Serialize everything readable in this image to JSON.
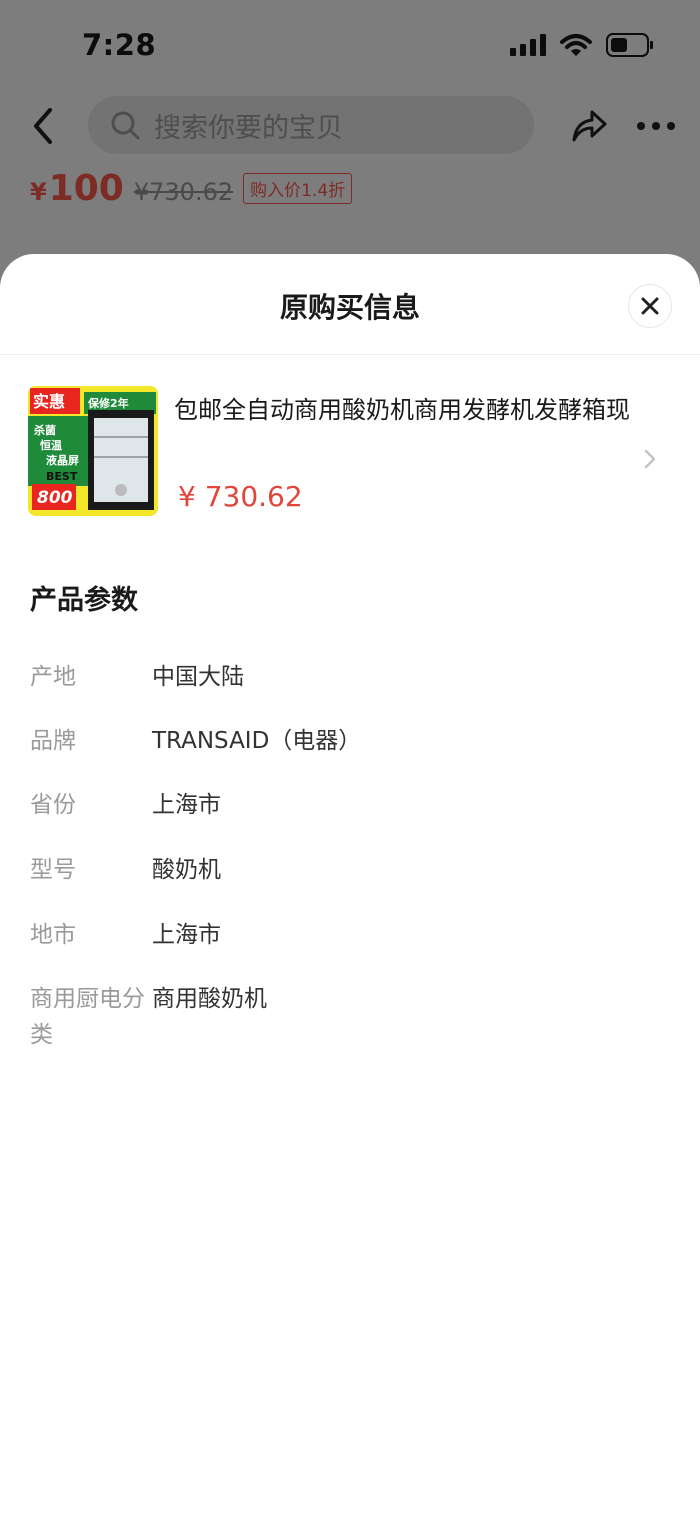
{
  "status_bar": {
    "time": "7:28"
  },
  "search": {
    "placeholder": "搜索你要的宝贝"
  },
  "price": {
    "currency": "¥",
    "current": "100",
    "original": "¥730.62",
    "discount_tag": "购入价1.4折"
  },
  "sheet": {
    "title": "原购买信息",
    "product": {
      "title": "包邮全自动商用酸奶机商用发酵机发酵箱现",
      "price": "¥ 730.62",
      "thumb_texts": {
        "badge_left": "实惠",
        "badge_right": "保修2年",
        "features": [
          "杀菌",
          "恒温",
          "液晶屏"
        ],
        "best": "BEST",
        "price": "800"
      }
    },
    "params_title": "产品参数",
    "params": [
      {
        "key": "产地",
        "value": "中国大陆"
      },
      {
        "key": "品牌",
        "value": "TRANSAID（电器）"
      },
      {
        "key": "省份",
        "value": "上海市"
      },
      {
        "key": "型号",
        "value": "酸奶机"
      },
      {
        "key": "地市",
        "value": "上海市"
      },
      {
        "key": "商用厨电分类",
        "value": "商用酸奶机"
      }
    ]
  },
  "icons": {
    "back": "back-icon",
    "search": "search-icon",
    "share": "share-icon",
    "more": "more-icon",
    "close": "close-icon",
    "chevron": "chevron-right-icon"
  },
  "colors": {
    "price_red": "#e2463a",
    "overlay": "#7d7d7d",
    "sheet_bg": "#ffffff"
  }
}
